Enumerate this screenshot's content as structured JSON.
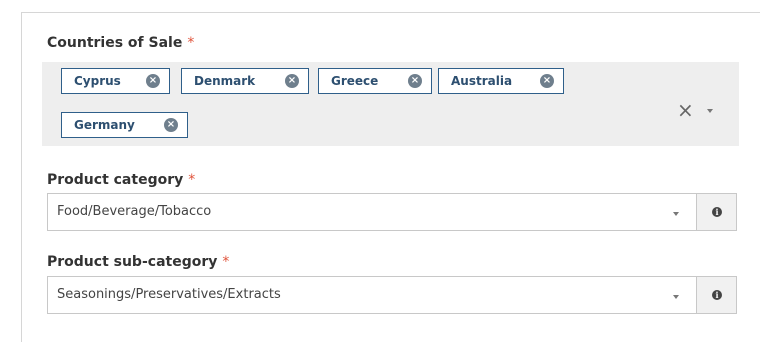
{
  "countries": {
    "label": "Countries of Sale",
    "required_mark": "*",
    "selected": [
      {
        "label": "Cyprus"
      },
      {
        "label": "Denmark"
      },
      {
        "label": "Greece"
      },
      {
        "label": "Australia"
      },
      {
        "label": "Germany"
      }
    ],
    "chip_remove_icon": "x-circle-icon",
    "clear_icon": "close-icon",
    "clear_glyph": "×",
    "dropdown_icon": "caret-down-icon"
  },
  "category": {
    "label": "Product category",
    "required_mark": "*",
    "value": "Food/Beverage/Tobacco",
    "dropdown_icon": "caret-down-icon",
    "info_icon": "info-icon"
  },
  "subcategory": {
    "label": "Product sub-category",
    "required_mark": "*",
    "value": "Seasonings/Preservatives/Extracts",
    "dropdown_icon": "caret-down-icon",
    "info_icon": "info-icon"
  },
  "colors": {
    "required": "#e0533b",
    "chip_border": "#2f5f8a",
    "chip_text": "#2d4f70",
    "multiselect_bg": "#eeeeee"
  }
}
